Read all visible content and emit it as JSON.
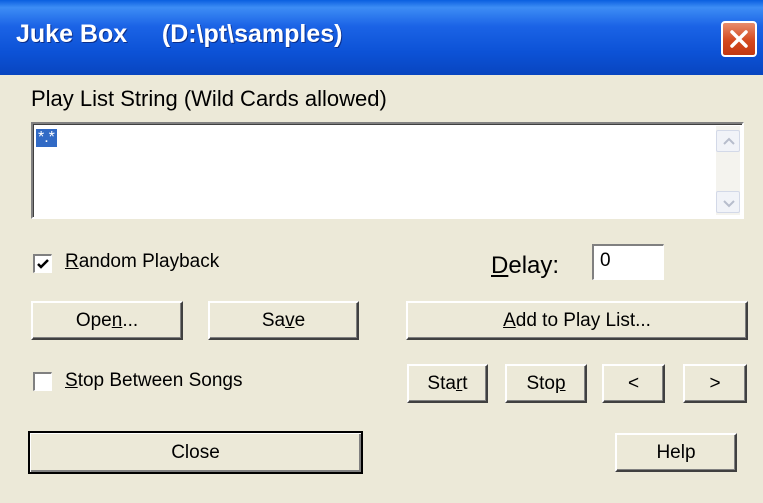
{
  "title_bar": {
    "title": "Juke Box     (D:\\pt\\samples)"
  },
  "play_list": {
    "label": "Play List String (Wild Cards allowed)",
    "value": "*.*"
  },
  "random_playback": {
    "label": "Random Playback",
    "checked": true
  },
  "delay": {
    "label": "Delay:",
    "value": "0"
  },
  "buttons": {
    "open": "Open...",
    "save": "Save",
    "add_to_play_list": "Add to Play List...",
    "start": "Start",
    "stop": "Stop",
    "prev": "<",
    "next": ">",
    "close": "Close",
    "help": "Help"
  },
  "stop_between_songs": {
    "label": "Stop Between Songs",
    "checked": false
  }
}
